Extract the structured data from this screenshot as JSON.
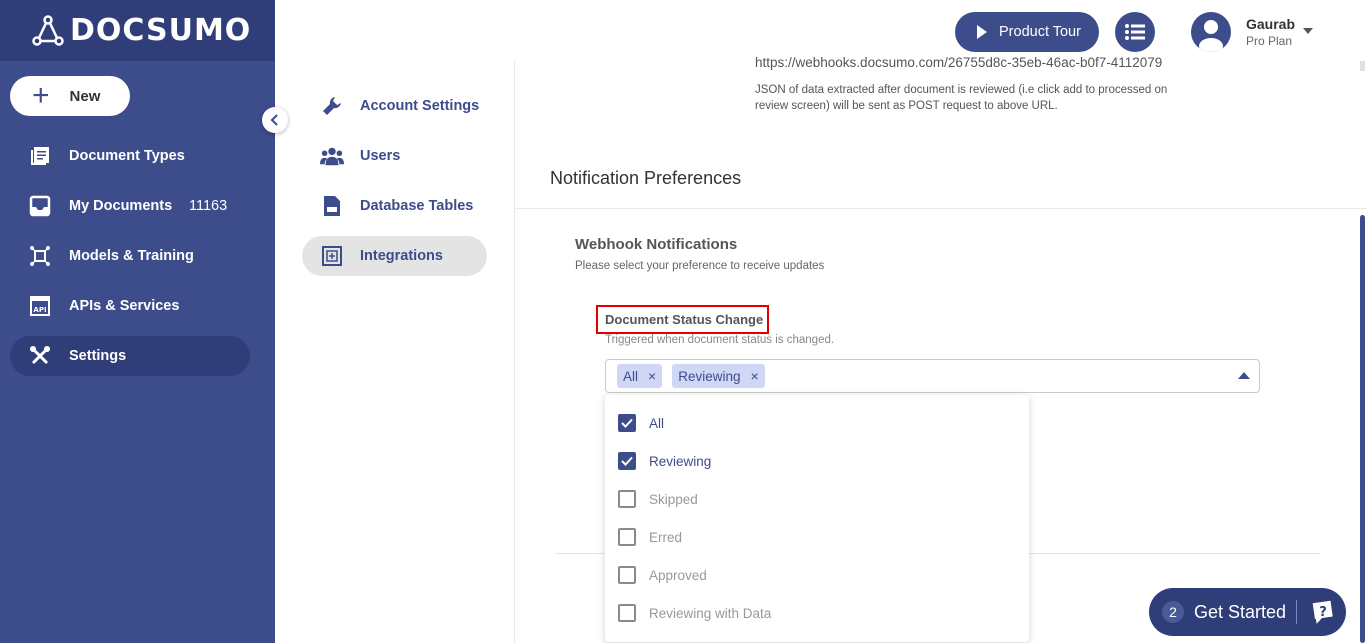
{
  "brand": {
    "name": "DOCSUMO"
  },
  "sidebar": {
    "new_label": "New",
    "items": [
      {
        "label": "Document Types",
        "icon": "document-types-icon"
      },
      {
        "label": "My Documents",
        "count": "11163",
        "icon": "inbox-icon"
      },
      {
        "label": "Models & Training",
        "icon": "ai-model-icon"
      },
      {
        "label": "APIs & Services",
        "icon": "api-icon"
      },
      {
        "label": "Settings",
        "icon": "wrench-screwdriver-icon",
        "active": true
      }
    ]
  },
  "header": {
    "tour_label": "Product Tour",
    "user_name": "Gaurab",
    "user_plan": "Pro Plan"
  },
  "settings_menu": {
    "items": [
      {
        "label": "Account Settings",
        "icon": "wrench-icon"
      },
      {
        "label": "Users",
        "icon": "users-icon"
      },
      {
        "label": "Database Tables",
        "icon": "csv-file-icon"
      },
      {
        "label": "Integrations",
        "icon": "integrations-icon",
        "active": true
      }
    ]
  },
  "webhook": {
    "url": "https://webhooks.docsumo.com/26755d8c-35eb-46ac-b0f7-4112079",
    "description": "JSON of data extracted after document is reviewed (i.e click add to processed on review screen) will be sent as POST request to above URL."
  },
  "notifications": {
    "title": "Notification Preferences",
    "webhook_title": "Webhook Notifications",
    "webhook_subtitle": "Please select your preference to receive updates",
    "status_change": {
      "label": "Document Status Change",
      "subtitle": "Triggered when document status is changed.",
      "selected_chips": [
        "All",
        "Reviewing"
      ],
      "options": [
        {
          "label": "All",
          "checked": true
        },
        {
          "label": "Reviewing",
          "checked": true
        },
        {
          "label": "Skipped",
          "checked": false
        },
        {
          "label": "Erred",
          "checked": false
        },
        {
          "label": "Approved",
          "checked": false
        },
        {
          "label": "Reviewing with Data",
          "checked": false
        }
      ]
    }
  },
  "get_started": {
    "count": "2",
    "label": "Get Started"
  },
  "colors": {
    "primary": "#3d4c8b",
    "sidebar_dark": "#2f3d78",
    "chip_bg": "#cfd6f6",
    "highlight_border": "#e00000"
  }
}
